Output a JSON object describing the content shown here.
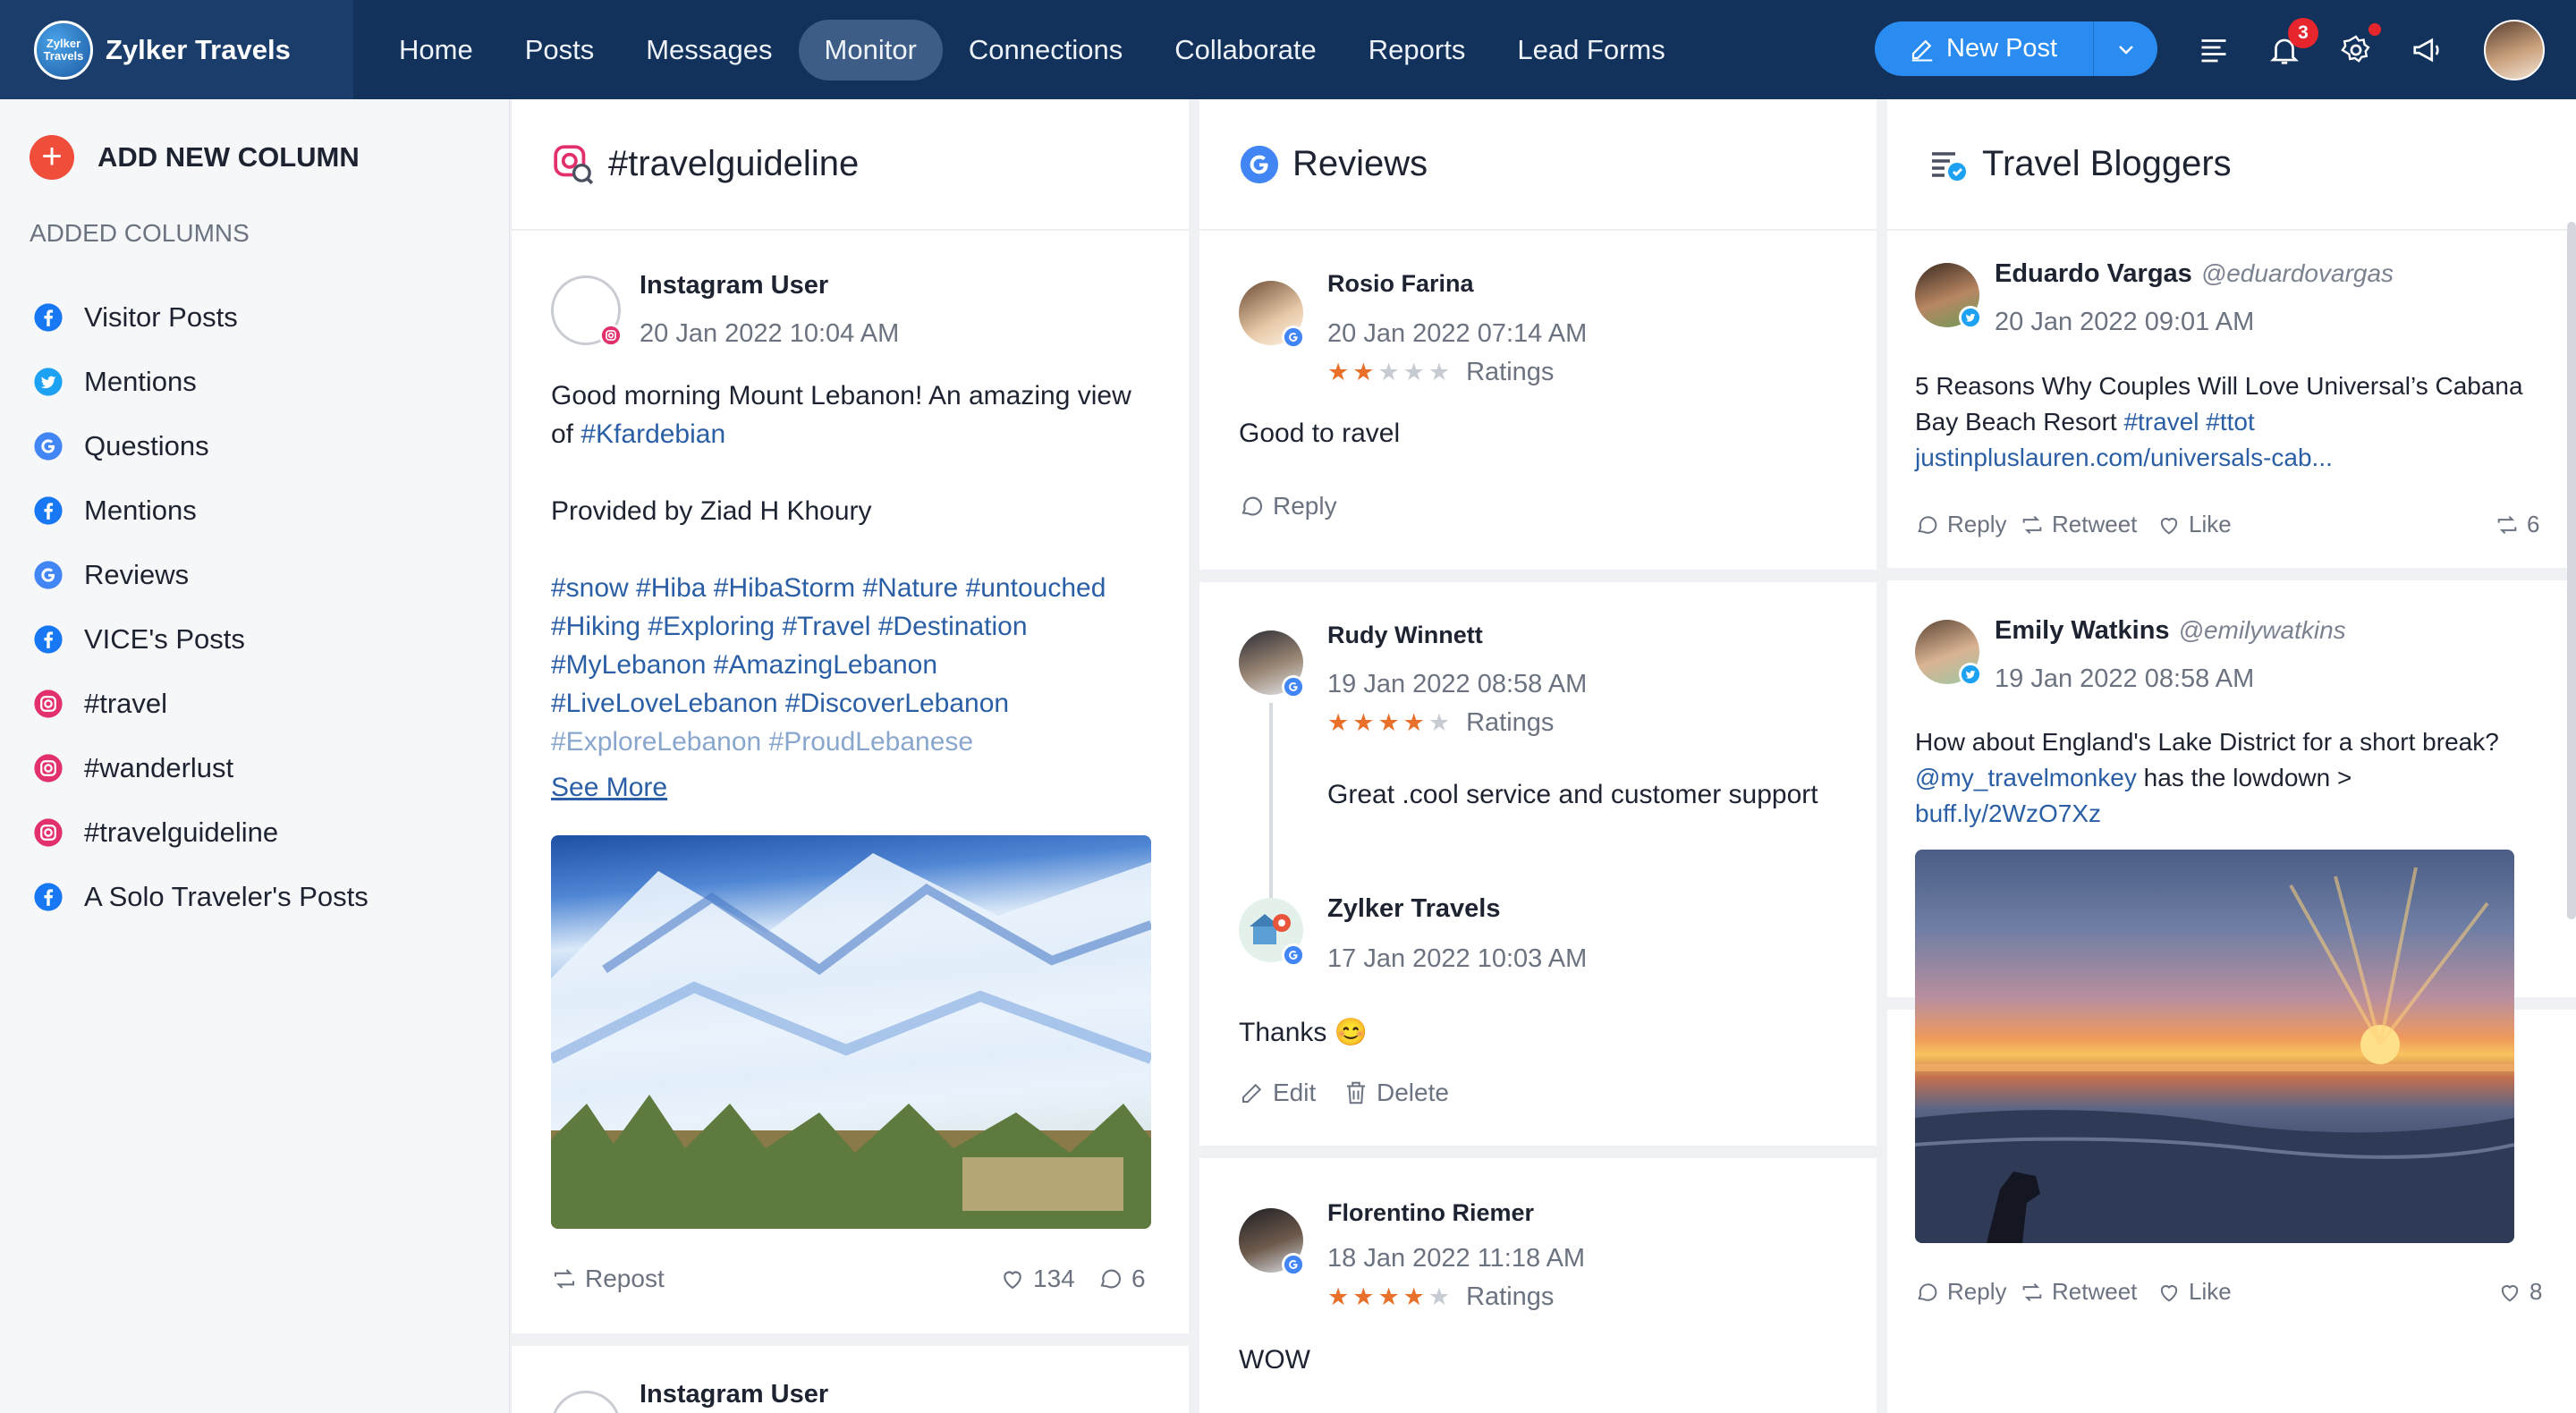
{
  "brand": {
    "name": "Zylker Travels",
    "logo_text": "Zylker Travels"
  },
  "nav": [
    "Home",
    "Posts",
    "Messages",
    "Monitor",
    "Connections",
    "Collaborate",
    "Reports",
    "Lead Forms"
  ],
  "nav_active": "Monitor",
  "new_post": {
    "label": "New Post"
  },
  "notifications": {
    "count": "3"
  },
  "sidebar": {
    "add_column": "ADD NEW COLUMN",
    "added_title": "ADDED COLUMNS",
    "items": [
      {
        "label": "Visitor Posts",
        "icon": "facebook-icon"
      },
      {
        "label": "Mentions",
        "icon": "twitter-icon"
      },
      {
        "label": "Questions",
        "icon": "google-icon"
      },
      {
        "label": "Mentions",
        "icon": "facebook-icon"
      },
      {
        "label": "Reviews",
        "icon": "google-icon"
      },
      {
        "label": "VICE's Posts",
        "icon": "facebook-icon"
      },
      {
        "label": "#travel",
        "icon": "instagram-icon"
      },
      {
        "label": "#wanderlust",
        "icon": "instagram-icon"
      },
      {
        "label": "#travelguideline",
        "icon": "instagram-icon"
      },
      {
        "label": "A Solo Traveler's Posts",
        "icon": "facebook-icon"
      }
    ]
  },
  "columns": {
    "instagram": {
      "title": "#travelguideline",
      "post1": {
        "user": "Instagram User",
        "date": "20 Jan 2022 10:04 AM",
        "text_a": "Good morning Mount Lebanon! An amazing view",
        "text_b_prefix": "of ",
        "text_b_tag": "#Kfardebian",
        "text_c": "Provided by Ziad H Khoury",
        "tags_1": "#snow #Hiba #HibaStorm #Nature #untouched",
        "tags_2": "#Hiking #Exploring #Travel #Destination",
        "tags_3": "#MyLebanon #AmazingLebanon",
        "tags_4": "#LiveLoveLebanon #DiscoverLebanon",
        "tags_5": "#ExploreLebanon #ProudLebanese",
        "see_more": "See More",
        "repost": "Repost",
        "likes": "134",
        "comments": "6"
      },
      "post2": {
        "user": "Instagram User"
      }
    },
    "reviews": {
      "title": "Reviews",
      "r1": {
        "user": "Rosio Farina",
        "date": "20 Jan 2022 07:14 AM",
        "rating": 2,
        "ratings_label": "Ratings",
        "text": "Good to ravel",
        "reply": "Reply"
      },
      "r2": {
        "user": "Rudy Winnett",
        "date": "19 Jan 2022 08:58 AM",
        "rating": 4,
        "ratings_label": "Ratings",
        "text": "Great .cool service and customer support"
      },
      "r2_reply": {
        "user": "Zylker Travels",
        "date": "17 Jan 2022 10:03 AM",
        "text": "Thanks 😊",
        "edit": "Edit",
        "delete": "Delete"
      },
      "r3": {
        "user": "Florentino Riemer",
        "date": "18 Jan 2022 11:18 AM",
        "rating": 4,
        "ratings_label": "Ratings",
        "text": "WOW"
      }
    },
    "bloggers": {
      "title": "Travel Bloggers",
      "t1": {
        "user": "Eduardo Vargas",
        "handle": "@eduardovargas",
        "date": "20 Jan 2022 09:01 AM",
        "line1": "5 Reasons Why Couples Will Love Universal’s Cabana",
        "line2_prefix": "Bay Beach Resort ",
        "line2_tags": "#travel #ttot",
        "line3_link": "justinpluslauren.com/universals-cab...",
        "reply": "Reply",
        "retweet": "Retweet",
        "like": "Like",
        "retweets": "6"
      },
      "t2": {
        "user": "Emily Watkins",
        "handle": "@emilywatkins",
        "date": "19 Jan 2022 08:58 AM",
        "line1": "How about England's Lake District for a short break?",
        "line2_link": "@my_travelmonkey",
        "line2_rest": " has the lowdown >",
        "line3_link": "buff.ly/2WzO7Xz",
        "reply": "Reply",
        "retweet": "Retweet",
        "like": "Like",
        "likes": "8"
      }
    }
  },
  "colors": {
    "topbar": "#13325b",
    "accent": "#2a8cf0",
    "link": "#2a5ea5",
    "star": "#e8702a",
    "add": "#ef4e3a"
  }
}
